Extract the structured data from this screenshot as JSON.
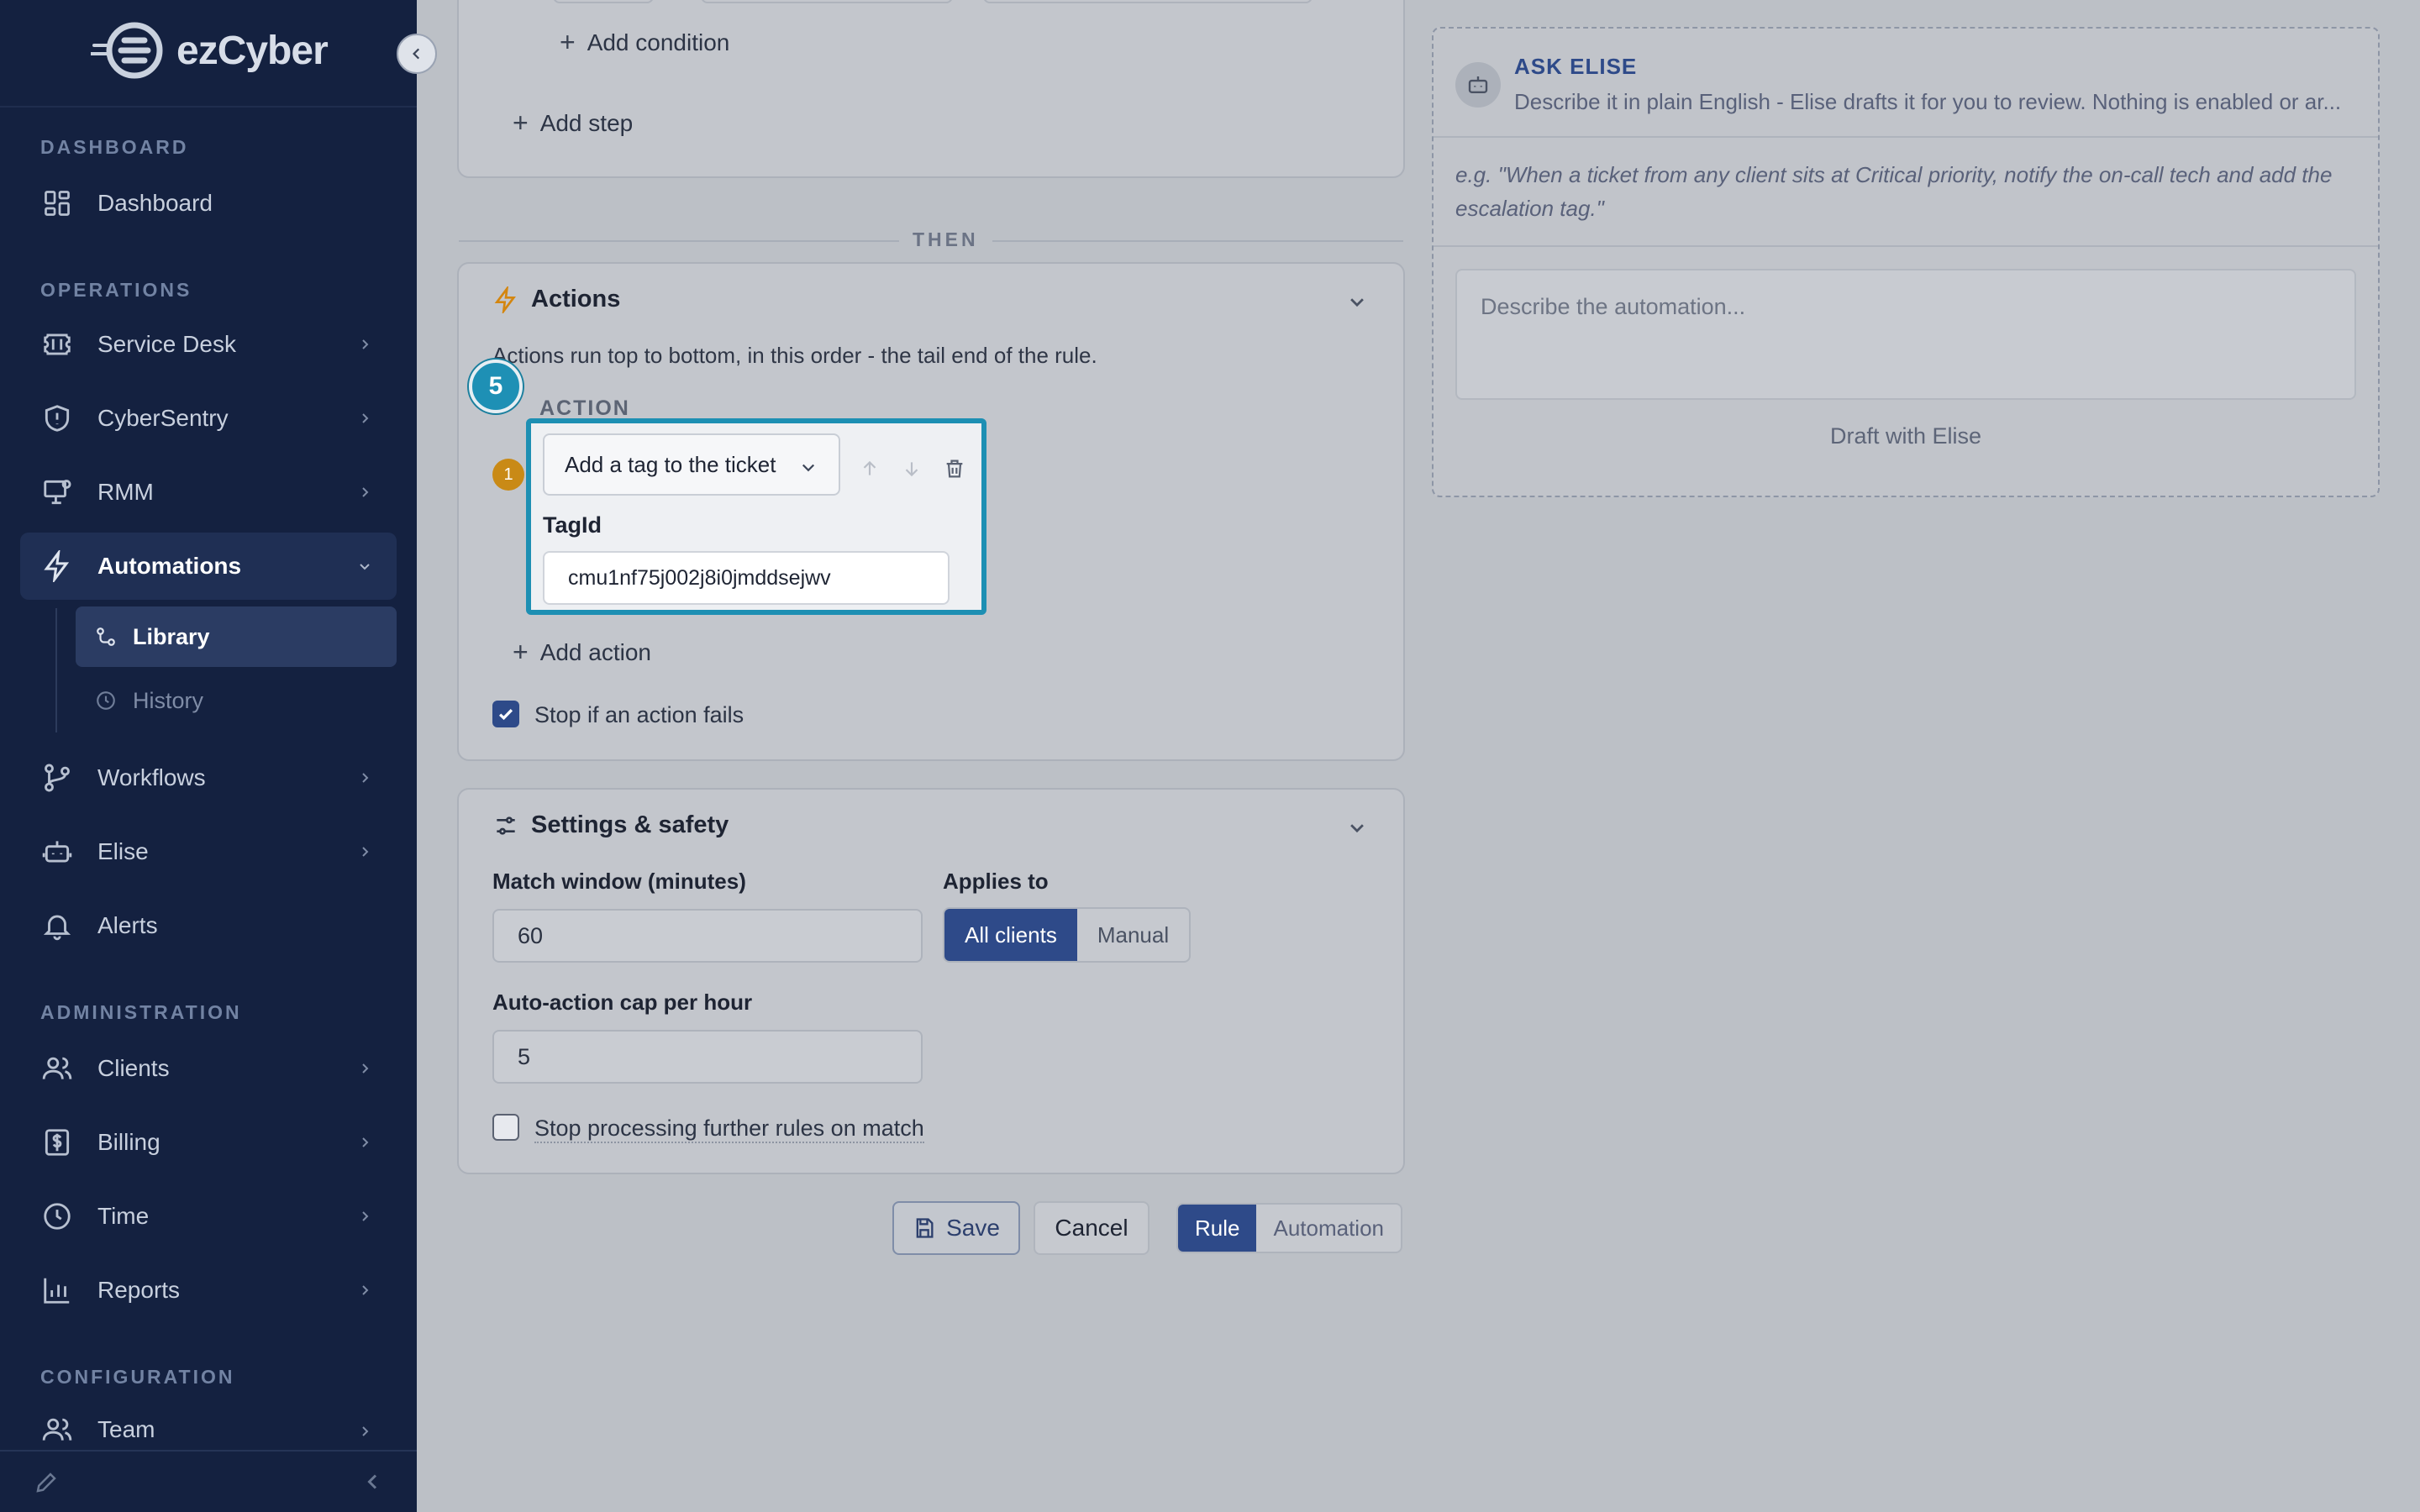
{
  "sidebar": {
    "brand": "ezCyber",
    "sections": {
      "dashboard": "DASHBOARD",
      "operations": "OPERATIONS",
      "administration": "ADMINISTRATION",
      "configuration": "CONFIGURATION"
    },
    "items": {
      "dashboard": "Dashboard",
      "service_desk": "Service Desk",
      "cybersentry": "CyberSentry",
      "rmm": "RMM",
      "automations": "Automations",
      "library": "Library",
      "history": "History",
      "workflows": "Workflows",
      "elise": "Elise",
      "alerts": "Alerts",
      "clients": "Clients",
      "billing": "Billing",
      "time": "Time",
      "reports": "Reports",
      "team": "Team"
    }
  },
  "conditions": {
    "add_condition": "Add condition",
    "add_step": "Add step"
  },
  "then_label": "THEN",
  "actions": {
    "title": "Actions",
    "description": "Actions run top to bottom, in this order - the tail end of the rule.",
    "step_badge": "5",
    "action_label": "ACTION",
    "action_number": "1",
    "action_type": "Add a tag to the ticket",
    "field_label": "TagId",
    "field_value": "cmu1nf75j002j8i0jmddsejwv",
    "add_action": "Add action",
    "stop_on_fail": "Stop if an action fails",
    "stop_on_fail_checked": true
  },
  "settings": {
    "title": "Settings & safety",
    "match_window_label": "Match window (minutes)",
    "match_window_value": "60",
    "applies_to_label": "Applies to",
    "applies_to_options": [
      "All clients",
      "Manual"
    ],
    "applies_to_selected": "All clients",
    "cap_label": "Auto-action cap per hour",
    "cap_value": "5",
    "stop_further": "Stop processing further rules on match",
    "stop_further_checked": false
  },
  "footer": {
    "save": "Save",
    "cancel": "Cancel",
    "mode_options": [
      "Rule",
      "Automation"
    ],
    "mode_selected": "Rule"
  },
  "elise": {
    "title": "ASK ELISE",
    "subtitle": "Describe it in plain English - Elise drafts it for you to review. Nothing is enabled or ar...",
    "example": "e.g. \"When a ticket from any client sits at Critical priority, notify the on-call tech and add the escalation tag.\"",
    "placeholder": "Describe the automation...",
    "draft_button": "Draft with Elise"
  },
  "colors": {
    "sidebar_bg": "#142140",
    "accent": "#2e4a89",
    "highlight": "#1d8fb3",
    "warning_dot": "#c98a16"
  }
}
